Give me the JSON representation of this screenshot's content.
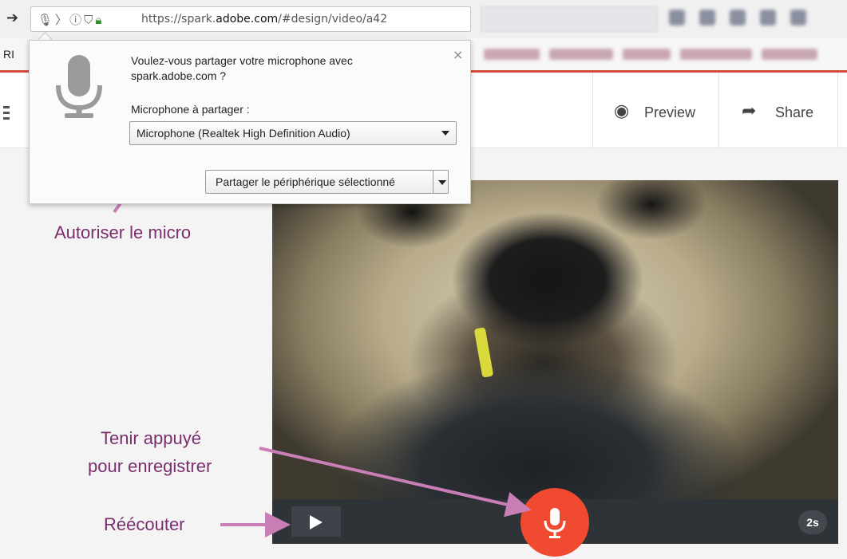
{
  "browser": {
    "url_prefix": "https://spark.",
    "url_domain": "adobe.com",
    "url_suffix": "/#design/video/a42",
    "bookmark_left": "RI"
  },
  "permission_popup": {
    "question": "Voulez-vous partager votre microphone avec spark.adobe.com ?",
    "mic_label": "Microphone à partager :",
    "selected_device": "Microphone (Realtek High Definition Audio)",
    "share_button": "Partager le périphérique sélectionné",
    "close": "×"
  },
  "app_header": {
    "preview_label": "Preview",
    "share_label": "Share"
  },
  "player": {
    "duration": "2s"
  },
  "annotations": {
    "allow_mic": "Autoriser le micro",
    "hold_line1": "Tenir appuyé",
    "hold_line2": "pour enregistrer",
    "replay": "Réécouter",
    "color": "#7a2e6e"
  },
  "colors": {
    "record": "#f04a30",
    "accent": "#d64d3e"
  }
}
